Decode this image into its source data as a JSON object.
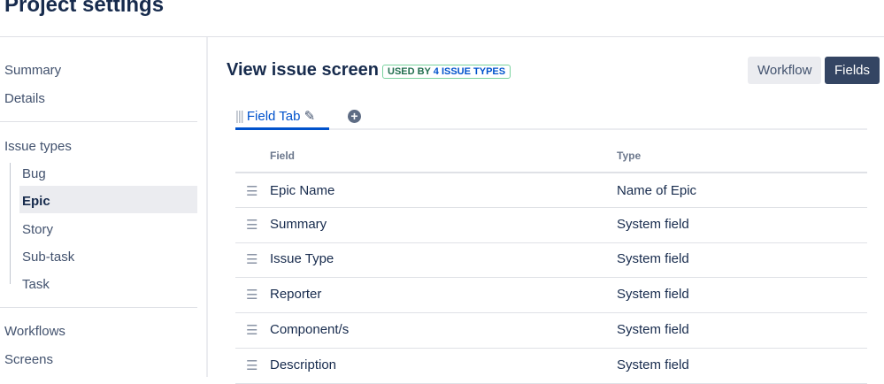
{
  "header": {
    "title": "Project settings"
  },
  "sidebar": {
    "items": [
      "Summary",
      "Details"
    ],
    "issue_types_label": "Issue types",
    "issue_types": [
      "Bug",
      "Epic",
      "Story",
      "Sub-task",
      "Task"
    ],
    "selected": "Epic",
    "bottom": [
      "Workflows",
      "Screens"
    ]
  },
  "main": {
    "title": "View issue screen",
    "badge_prefix": "USED BY ",
    "badge_link": "4 ISSUE TYPES",
    "workflow_button": "Workflow",
    "fields_button": "Fields",
    "tab": "Field Tab",
    "columns": [
      "Field",
      "Type"
    ],
    "rows": [
      {
        "field": "Epic Name",
        "type": "Name of Epic"
      },
      {
        "field": "Summary",
        "type": "System field"
      },
      {
        "field": "Issue Type",
        "type": "System field"
      },
      {
        "field": "Reporter",
        "type": "System field"
      },
      {
        "field": "Component/s",
        "type": "System field"
      },
      {
        "field": "Description",
        "type": "System field"
      }
    ]
  }
}
